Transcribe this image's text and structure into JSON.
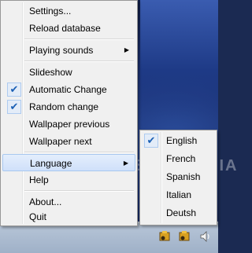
{
  "main_menu": {
    "items": [
      {
        "label": "Settings..."
      },
      {
        "label": "Reload database"
      },
      {
        "label": "Playing sounds"
      },
      {
        "label": "Slideshow"
      },
      {
        "label": "Automatic Change"
      },
      {
        "label": "Random change"
      },
      {
        "label": "Wallpaper previous"
      },
      {
        "label": "Wallpaper next"
      },
      {
        "label": "Language"
      },
      {
        "label": "Help"
      },
      {
        "label": "About..."
      },
      {
        "label": "Quit"
      }
    ]
  },
  "language_menu": {
    "items": [
      {
        "label": "English"
      },
      {
        "label": "French"
      },
      {
        "label": "Spanish"
      },
      {
        "label": "Italian"
      },
      {
        "label": "Deutsh"
      }
    ]
  },
  "watermark": {
    "text": "SOFTPEDIA"
  },
  "icons": {
    "check": "check-icon",
    "submenu": "submenu-arrow-icon",
    "tray": [
      "app-tray-icon",
      "app-tray-icon-2",
      "speaker-icon"
    ]
  },
  "colors": {
    "menu_bg": "#f0f0f0",
    "highlight": "#cfe0fa",
    "taskbar": "#a9b9ce"
  }
}
